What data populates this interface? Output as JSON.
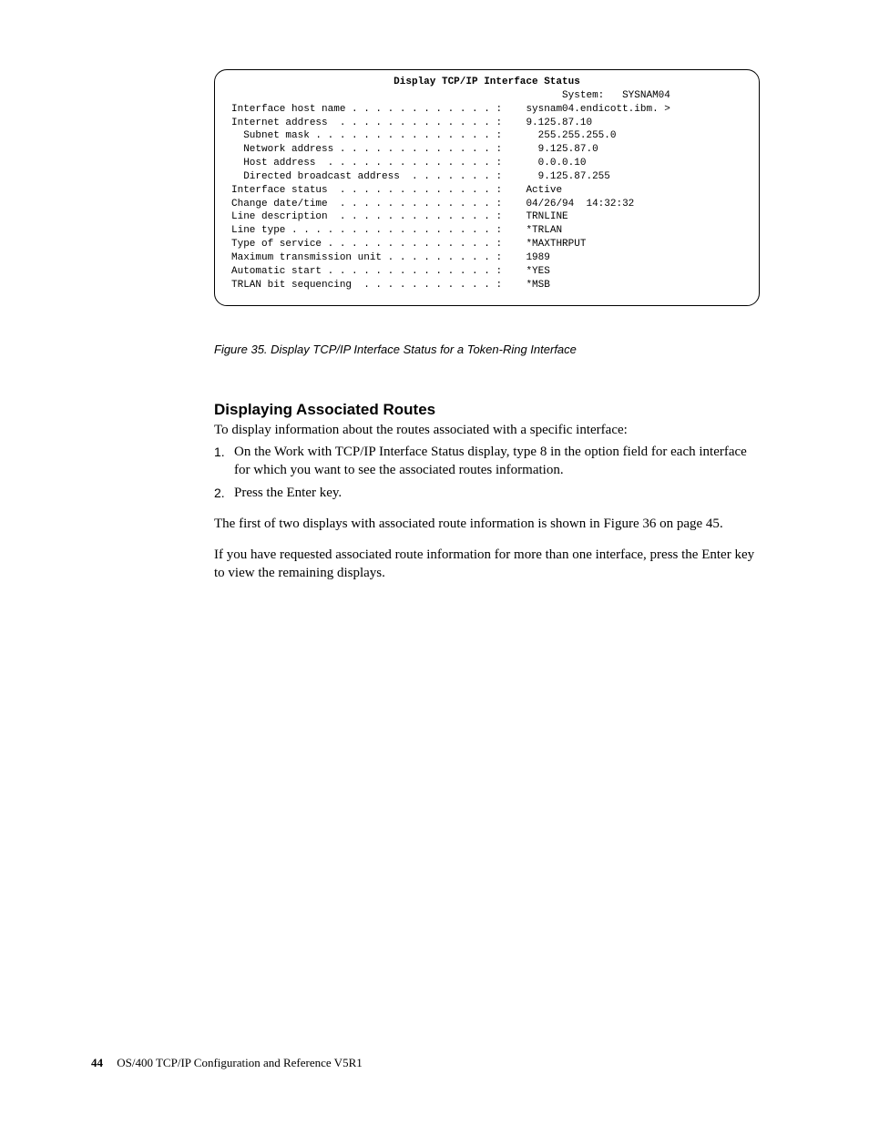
{
  "terminal": {
    "title": "Display TCP/IP Interface Status",
    "system_line": "                                                       System:   SYSNAM04",
    "lines": [
      "Interface host name . . . . . . . . . . . . :    sysnam04.endicott.ibm. >",
      "Internet address  . . . . . . . . . . . . . :    9.125.87.10",
      "  Subnet mask . . . . . . . . . . . . . . . :      255.255.255.0",
      "  Network address . . . . . . . . . . . . . :      9.125.87.0",
      "  Host address  . . . . . . . . . . . . . . :      0.0.0.10",
      "  Directed broadcast address  . . . . . . . :      9.125.87.255",
      "",
      "Interface status  . . . . . . . . . . . . . :    Active",
      "Change date/time  . . . . . . . . . . . . . :    04/26/94  14:32:32",
      "Line description  . . . . . . . . . . . . . :    TRNLINE",
      "Line type . . . . . . . . . . . . . . . . . :    *TRLAN",
      "Type of service . . . . . . . . . . . . . . :    *MAXTHRPUT",
      "Maximum transmission unit . . . . . . . . . :    1989",
      "Automatic start . . . . . . . . . . . . . . :    *YES",
      "",
      "TRLAN bit sequencing  . . . . . . . . . . . :    *MSB"
    ]
  },
  "figure_caption": "Figure 35. Display TCP/IP Interface Status for a Token-Ring Interface",
  "section_heading": "Displaying Associated Routes",
  "intro": "To display information about the routes associated with a specific interface:",
  "steps": {
    "n1": "1.",
    "s1": "On the Work with TCP/IP Interface Status display, type 8 in the option field for each interface for which you want to see the associated routes information.",
    "n2": "2.",
    "s2": "Press the Enter key."
  },
  "para1_a": "The first of two displays with associated route information is shown in ",
  "para1_link1": "Figure 36",
  "para1_space": " ",
  "para1_link2": "on page 45",
  "para1_b": ".",
  "para2": "If you have requested associated route information for more than one interface, press the Enter key to view the remaining displays.",
  "footer": {
    "page_number": "44",
    "doc_title": "OS/400 TCP/IP Configuration and Reference V5R1"
  }
}
